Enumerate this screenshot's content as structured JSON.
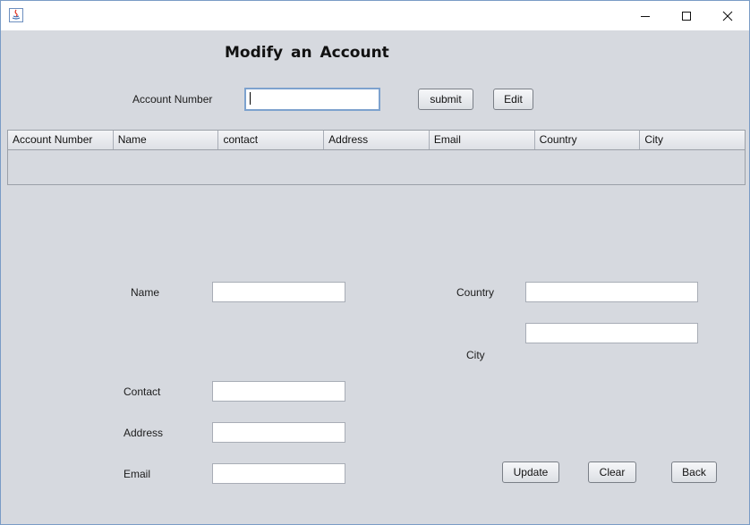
{
  "window": {
    "title": ""
  },
  "page": {
    "title": "Modify  an  Account"
  },
  "search": {
    "account_number_label": "Account Number",
    "account_number_value": "",
    "submit_label": "submit",
    "edit_label": "Edit"
  },
  "table": {
    "columns": [
      "Account Number",
      "Name",
      "contact",
      "Address",
      "Email",
      "Country",
      "City"
    ],
    "rows": []
  },
  "form": {
    "name_label": "Name",
    "name_value": "",
    "contact_label": "Contact",
    "contact_value": "",
    "address_label": "Address",
    "address_value": "",
    "email_label": "Email",
    "email_value": "",
    "country_label": "Country",
    "country_value": "",
    "city_label": "City",
    "city_value": ""
  },
  "actions": {
    "update_label": "Update",
    "clear_label": "Clear",
    "back_label": "Back"
  }
}
